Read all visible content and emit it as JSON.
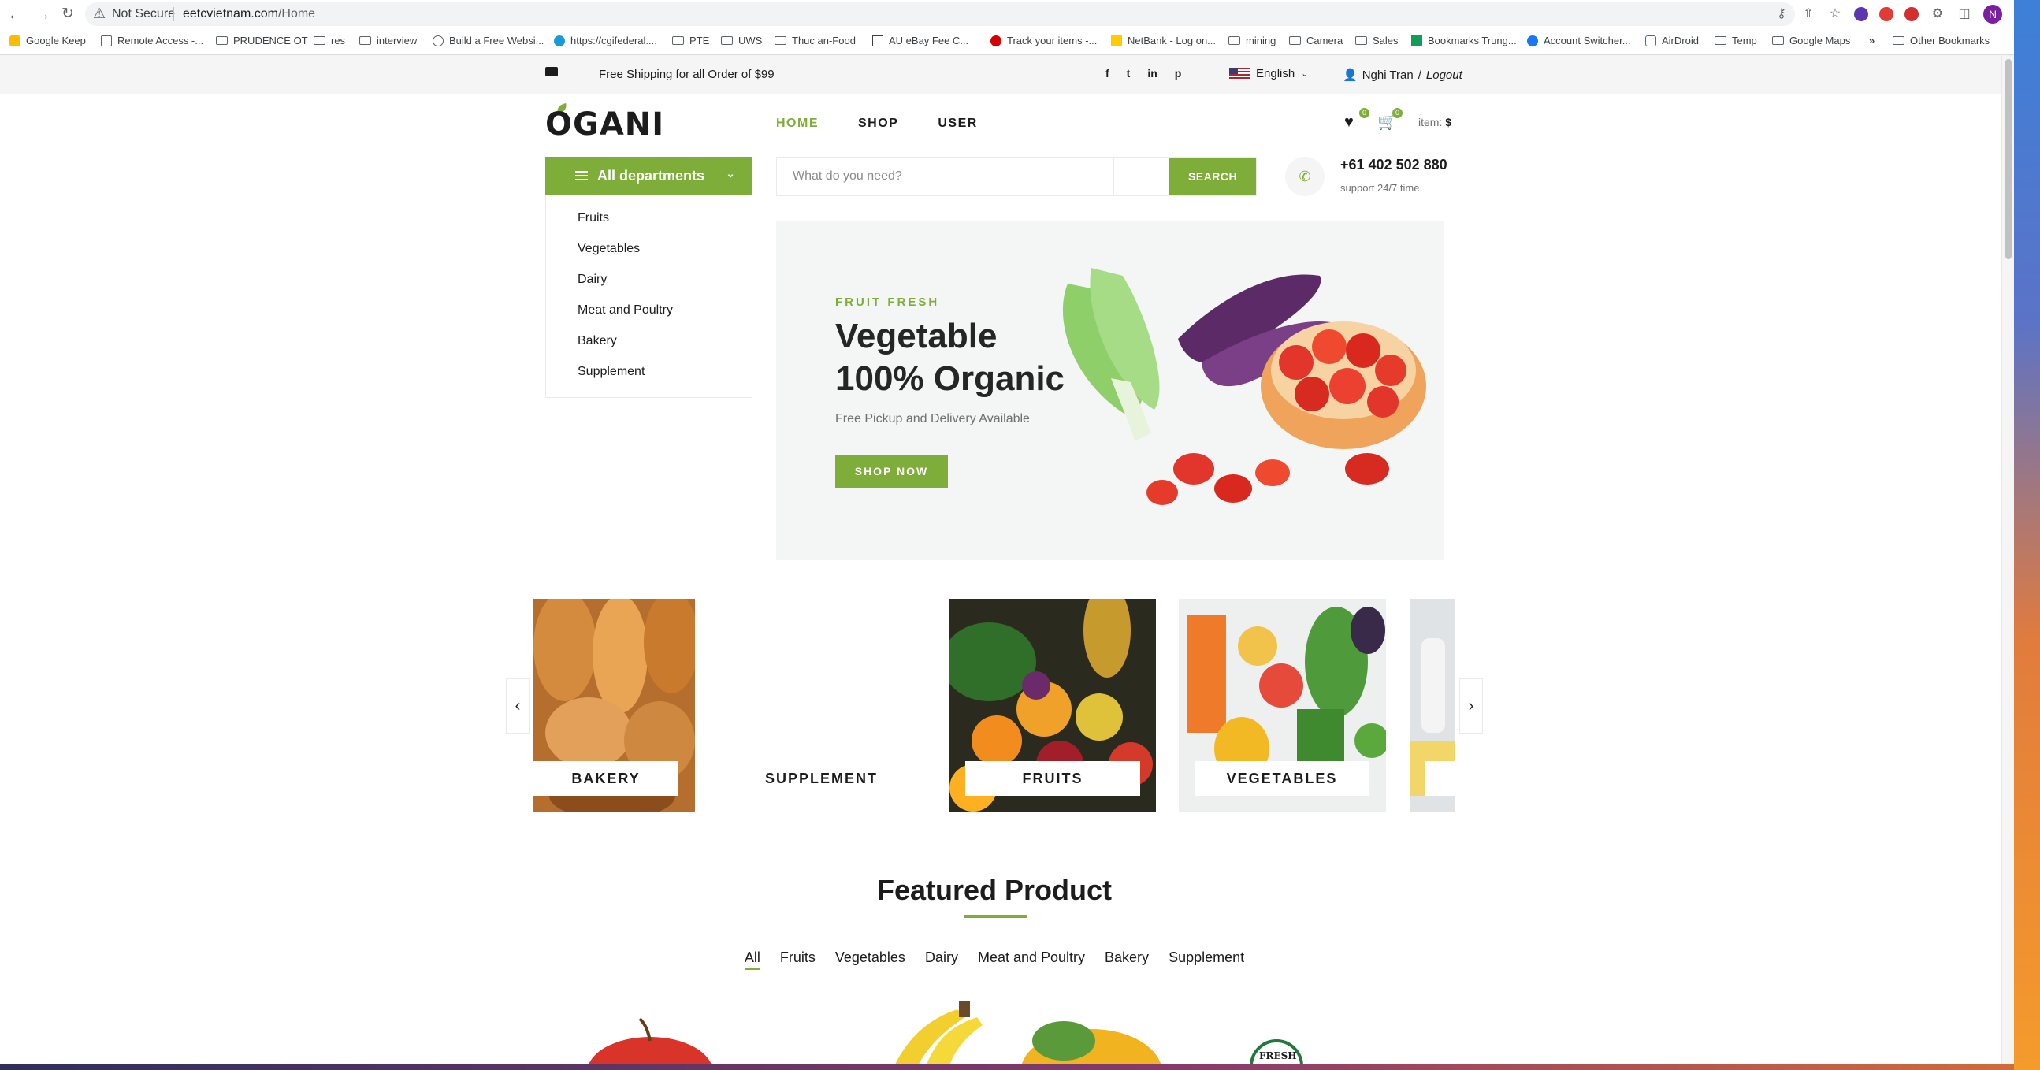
{
  "browser": {
    "security": "Not Secure",
    "url_host": "eetcvietnam.com",
    "url_path": "/Home",
    "profile_initial": "N"
  },
  "bookmarks": [
    "Google Keep",
    "Remote Access -...",
    "PRUDENCE OT",
    "res",
    "interview",
    "Build a Free Websi...",
    "https://cgifederal....",
    "PTE",
    "UWS",
    "Thuc an-Food",
    "AU eBay Fee C...",
    "Track your items -...",
    "NetBank - Log on...",
    "mining",
    "Camera",
    "Sales",
    "Bookmarks Trung...",
    "Account Switcher...",
    "AirDroid",
    "Temp",
    "Google Maps"
  ],
  "bookmarks_overflow": "»",
  "bookmarks_other": "Other Bookmarks",
  "topbar": {
    "shipping": "Free Shipping for all Order of $99",
    "social": [
      "f",
      "t",
      "in",
      "p"
    ],
    "language": "English",
    "user_name": "Nghi Tran",
    "logout": "Logout"
  },
  "header": {
    "logo": "OGANI",
    "nav": [
      "HOME",
      "SHOP",
      "USER"
    ],
    "wishlist_count": "0",
    "cart_count": "0",
    "item_label": "item:",
    "item_value": "$"
  },
  "departments": {
    "title": "All departments",
    "items": [
      "Fruits",
      "Vegetables",
      "Dairy",
      "Meat and Poultry",
      "Bakery",
      "Supplement"
    ]
  },
  "search": {
    "placeholder": "What do you need?",
    "button": "SEARCH"
  },
  "contact": {
    "phone": "+61 402 502 880",
    "support": "support 24/7 time"
  },
  "hero": {
    "kicker": "FRUIT FRESH",
    "title_line1": "Vegetable",
    "title_line2": "100% Organic",
    "subtitle": "Free Pickup and Delivery Available",
    "button": "SHOP NOW"
  },
  "categories": [
    "BAKERY",
    "SUPPLEMENT",
    "FRUITS",
    "VEGETABLES"
  ],
  "featured": {
    "title": "Featured Product",
    "filters": [
      "All",
      "Fruits",
      "Vegetables",
      "Dairy",
      "Meat and Poultry",
      "Bakery",
      "Supplement"
    ],
    "fresh_badge": "FRESH"
  },
  "colors": {
    "accent": "#7fad39",
    "text": "#1c1c1c"
  }
}
